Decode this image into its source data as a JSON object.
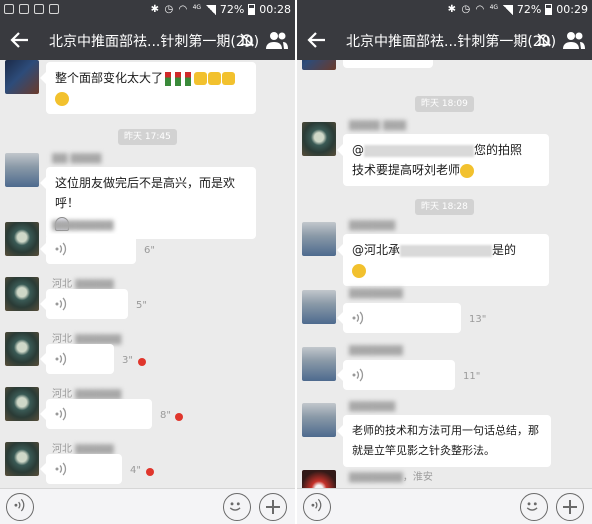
{
  "panels": [
    {
      "status": {
        "percent": "72%",
        "time": "00:28",
        "network": "4G"
      },
      "title": "北京中推面部祛...针刺第一期(20)",
      "timestamp": "昨天 17:45",
      "messages": [
        {
          "type": "text",
          "text": "整个面部变化太大了"
        },
        {
          "type": "text",
          "text": "这位朋友做完后不是高兴，而是欢呼！"
        },
        {
          "type": "voice",
          "duration": "6\"",
          "unread": false
        },
        {
          "type": "voice",
          "sender": "河北",
          "duration": "5\"",
          "unread": false
        },
        {
          "type": "voice",
          "sender": "河北",
          "duration": "3\"",
          "unread": true
        },
        {
          "type": "voice",
          "sender": "河北",
          "duration": "8\"",
          "unread": true
        },
        {
          "type": "voice",
          "sender": "河北",
          "duration": "4\"",
          "unread": true
        }
      ]
    },
    {
      "status": {
        "percent": "72%",
        "time": "00:29",
        "network": "4G"
      },
      "title": "北京中推面部祛...针刺第一期(20)",
      "timestamps": [
        "昨天 18:09",
        "昨天 18:28"
      ],
      "messages": [
        {
          "type": "text",
          "prefix": "@",
          "text": "您的拍照技术要提高呀刘老师",
          "line1": "您的拍照",
          "line2": "技术要提高呀刘老师"
        },
        {
          "type": "text",
          "prefix": "@河北承",
          "suffix": "是的"
        },
        {
          "type": "voice",
          "duration": "13\"",
          "unread": false
        },
        {
          "type": "voice",
          "duration": "11\"",
          "unread": false
        },
        {
          "type": "text",
          "line1": "老师的技术和方法可用一句话总结，那",
          "line2": "就是立竿见影之针灸整形法。"
        },
        {
          "type": "partial",
          "sender_tail": "，淮安"
        }
      ]
    }
  ],
  "icons": {
    "back": "back-arrow-icon",
    "mute": "mute-bell-icon",
    "group": "group-members-icon",
    "voice_input": "voice-input-icon",
    "emoji": "emoji-icon",
    "more": "plus-icon",
    "voice_wave": "voice-wave-icon"
  },
  "colors": {
    "titlebar": "#393a3f",
    "chat_bg": "#ebebeb",
    "bubble": "#ffffff",
    "unread": "#e0362c",
    "timestamp_bg": "#d2d2d2"
  }
}
